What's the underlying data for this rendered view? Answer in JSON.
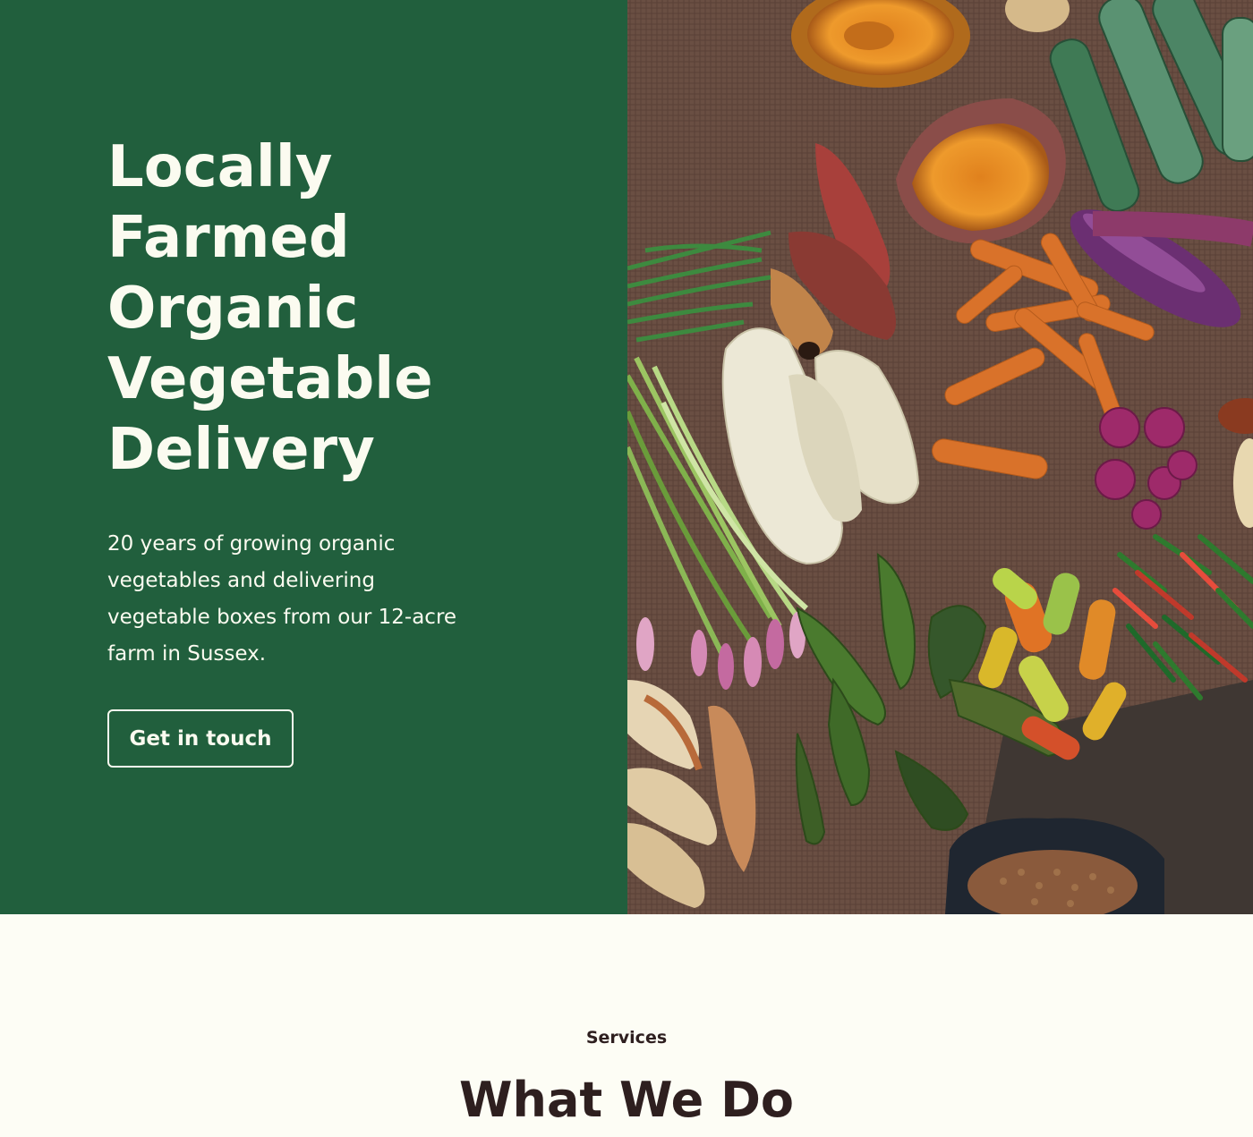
{
  "hero": {
    "headline_lines": [
      "Locally",
      "Farmed",
      "Organic",
      "Vegetable",
      "Delivery"
    ],
    "tagline": "20 years of growing organic vegetables and delivering vegetable boxes from our 12-acre farm in Sussex.",
    "cta_label": "Get in touch",
    "image_alt": "Assorted fresh vegetables on burlap",
    "colors": {
      "panel": "#215f3d",
      "text": "#fbfbf0"
    }
  },
  "services": {
    "eyebrow": "Services",
    "title": "What We Do",
    "colors": {
      "background": "#fdfdf5",
      "text": "#2e1f1f"
    }
  }
}
